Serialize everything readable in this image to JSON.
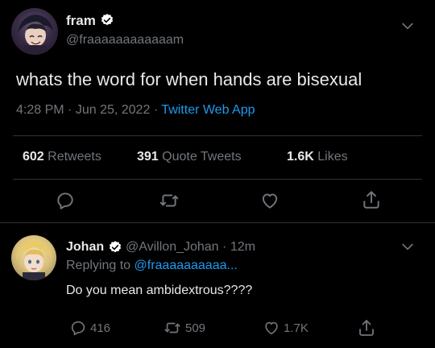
{
  "tweet": {
    "author_name": "fram",
    "author_handle": "@fraaaaaaaaaaaam",
    "text": "whats the word for when hands are bisexual",
    "meta": {
      "time": "4:28 PM",
      "sep1": "·",
      "date": "Jun 25, 2022",
      "sep2": "·",
      "source": "Twitter Web App"
    },
    "stats": {
      "retweets_count": "602",
      "retweets_label": "Retweets",
      "quote_count": "391",
      "quote_label": "Quote Tweets",
      "likes_count": "1.6K",
      "likes_label": "Likes"
    }
  },
  "reply": {
    "author_name": "Johan",
    "author_handle": "@Avillon_Johan",
    "sep": "·",
    "time": "12m",
    "replying_prefix": "Replying to",
    "replying_to": "@fraaaaaaaaaa...",
    "text": "Do you mean ambidextrous????",
    "actions": {
      "replies": "416",
      "retweets": "509",
      "likes": "1.7K"
    }
  },
  "colors": {
    "background": "#000000",
    "text": "#e7e9ea",
    "muted": "#71767b",
    "link": "#1d9bf0",
    "divider": "#2f3336",
    "verified": "#ffffff"
  },
  "icons": {
    "menu": "chevron-down-icon",
    "verified": "verified-badge-icon",
    "reply": "reply-icon",
    "retweet": "retweet-icon",
    "like": "heart-icon",
    "share": "share-icon"
  }
}
